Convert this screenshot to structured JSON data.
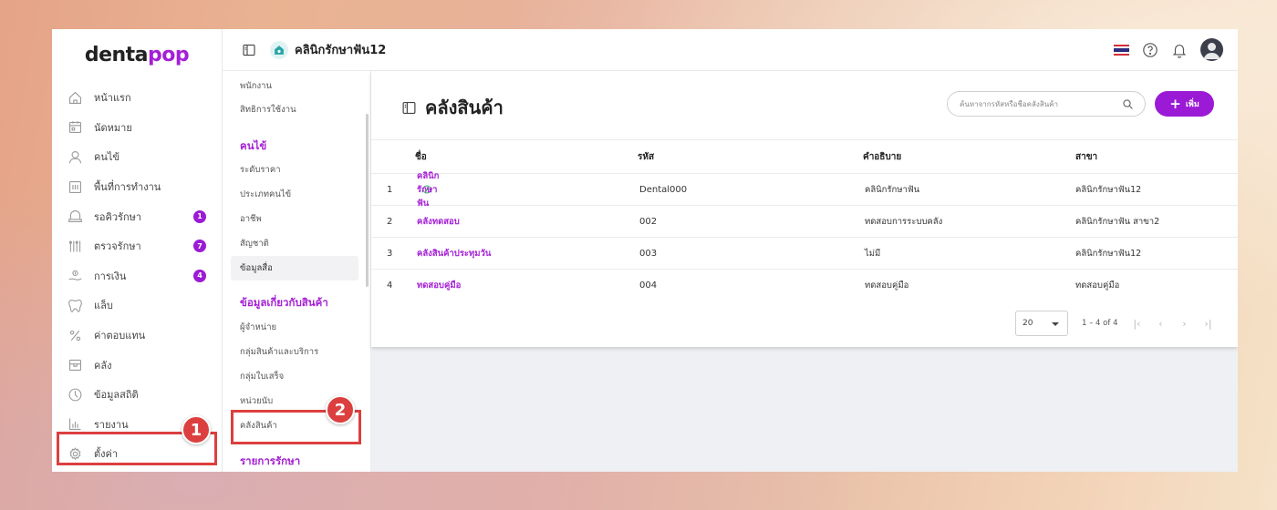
{
  "brand": {
    "logo_main": "denta",
    "logo_accent": "pop",
    "accent_color": "#a51fd6",
    "badge_color": "#9b1ad6"
  },
  "header": {
    "clinic_name": "คลินิกรักษาฟัน12"
  },
  "sidebar": {
    "items": [
      {
        "label": "หน้าแรก",
        "icon": "home-icon"
      },
      {
        "label": "นัดหมาย",
        "icon": "calendar-icon"
      },
      {
        "label": "คนไข้",
        "icon": "user-icon"
      },
      {
        "label": "พื้นที่การทำงาน",
        "icon": "workspace-icon"
      },
      {
        "label": "รอคิวรักษา",
        "icon": "chair-icon",
        "badge": "1"
      },
      {
        "label": "ตรวจรักษา",
        "icon": "tools-icon",
        "badge": "7"
      },
      {
        "label": "การเงิน",
        "icon": "payment-icon",
        "badge": "4"
      },
      {
        "label": "แล็บ",
        "icon": "tooth-icon"
      },
      {
        "label": "ค่าตอบแทน",
        "icon": "percent-icon"
      },
      {
        "label": "คลัง",
        "icon": "box-icon"
      },
      {
        "label": "ข้อมูลสถิติ",
        "icon": "stats-icon"
      },
      {
        "label": "รายงาน",
        "icon": "report-icon"
      },
      {
        "label": "ตั้งค่า",
        "icon": "gear-icon"
      }
    ]
  },
  "submenu": {
    "top_items": [
      "พนักงาน",
      "สิทธิการใช้งาน"
    ],
    "section_patient": "คนไข้",
    "patient_items": [
      "ระดับราคา",
      "ประเภทคนไข้",
      "อาชีพ",
      "สัญชาติ",
      "ข้อมูลสื่อ"
    ],
    "section_product": "ข้อมูลเกี่ยวกับสินค้า",
    "product_items": [
      "ผู้จำหน่าย",
      "กลุ่มสินค้าและบริการ",
      "กลุ่มใบเสร็จ",
      "หน่วยนับ",
      "คลังสินค้า"
    ],
    "section_treatment": "รายการรักษา"
  },
  "main": {
    "title": "คลังสินค้า",
    "search_placeholder": "ค้นหาจากรหัสหรือชื่อคลังสินค้า",
    "add_label": "เพิ่ม",
    "columns": [
      "ชื่อ",
      "รหัส",
      "คำอธิบาย",
      "สาขา"
    ],
    "rows": [
      {
        "num": "1",
        "name": "คลินิกรักษาฟัน",
        "code": "Dental000",
        "desc": "คลินิกรักษาฟัน",
        "branch": "คลินิกรักษาฟัน12",
        "verified": true
      },
      {
        "num": "2",
        "name": "คลังทดสอบ",
        "code": "002",
        "desc": "ทดสอบการระบบคลัง",
        "branch": "คลินิกรักษาฟัน สาขา2"
      },
      {
        "num": "3",
        "name": "คลังสินค้าประทุมวัน",
        "code": "003",
        "desc": "ไม่มี",
        "branch": "คลินิกรักษาฟัน12"
      },
      {
        "num": "4",
        "name": "ทดสอบคู่มือ",
        "code": "004",
        "desc": "ทดสอบคู่มือ",
        "branch": "ทดสอบคู่มือ"
      }
    ],
    "pagination": {
      "page_size": "20",
      "range": "1 – 4 of 4"
    }
  },
  "annotations": {
    "step1": "1",
    "step2": "2",
    "highlight_color": "#dc3f3f"
  }
}
